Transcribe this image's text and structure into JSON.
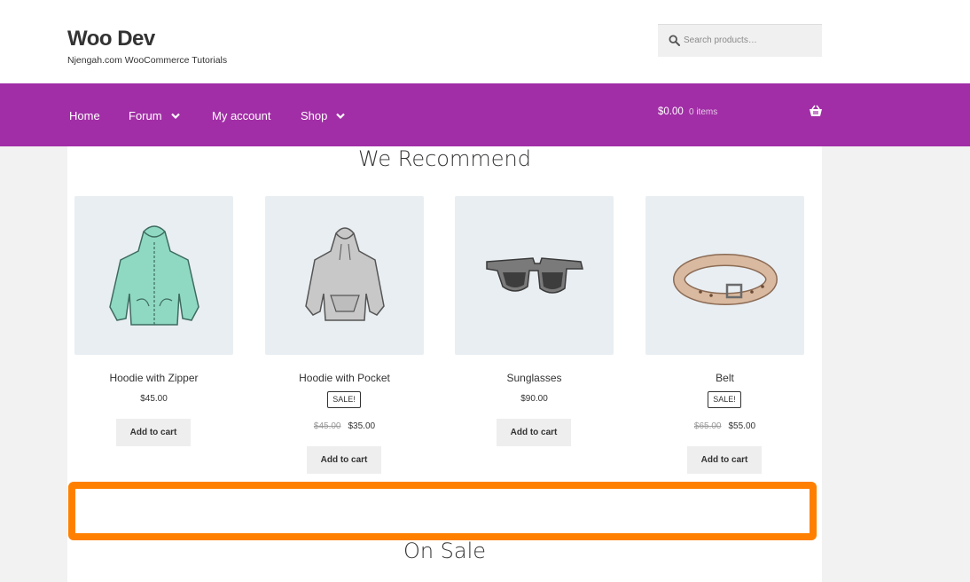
{
  "header": {
    "site_title": "Woo Dev",
    "tagline": "Njengah.com WooCommerce Tutorials",
    "search_placeholder": "Search products…"
  },
  "nav": {
    "items": [
      {
        "label": "Home",
        "has_dropdown": false
      },
      {
        "label": "Forum",
        "has_dropdown": true
      },
      {
        "label": "My account",
        "has_dropdown": false
      },
      {
        "label": "Shop",
        "has_dropdown": true
      }
    ],
    "cart_amount": "$0.00",
    "cart_count": "0 items",
    "background_color": "#a12ea6"
  },
  "recommend": {
    "title": "We Recommend",
    "products": [
      {
        "name": "Hoodie with Zipper",
        "price": "$45.00",
        "sale": false,
        "button": "Add to cart"
      },
      {
        "name": "Hoodie with Pocket",
        "sale_badge": "SALE!",
        "old_price": "$45.00",
        "price": "$35.00",
        "sale": true,
        "button": "Add to cart"
      },
      {
        "name": "Sunglasses",
        "price": "$90.00",
        "sale": false,
        "button": "Add to cart"
      },
      {
        "name": "Belt",
        "sale_badge": "SALE!",
        "old_price": "$65.00",
        "price": "$55.00",
        "sale": true,
        "button": "Add to cart"
      }
    ]
  },
  "on_sale": {
    "title": "On Sale"
  },
  "highlight_color": "#ff8000"
}
